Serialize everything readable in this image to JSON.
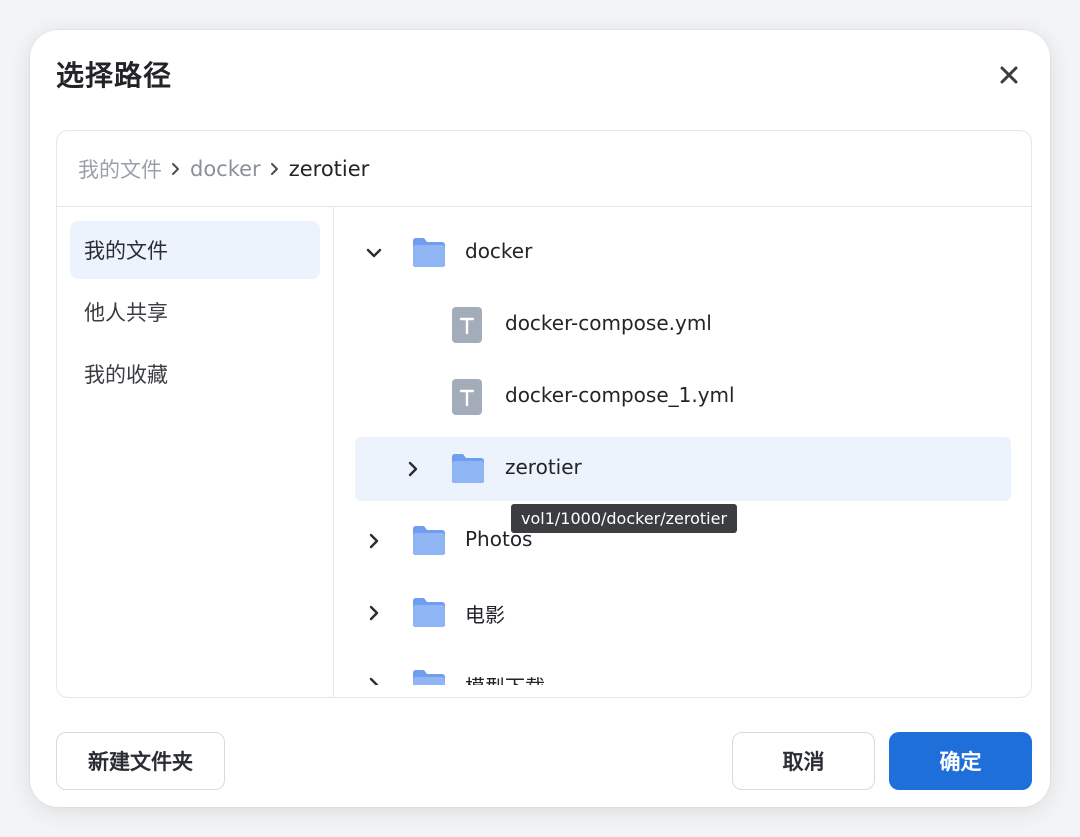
{
  "dialog": {
    "title": "选择路径",
    "close_icon": "close-icon"
  },
  "breadcrumb": {
    "items": [
      "我的文件",
      "docker",
      "zerotier"
    ]
  },
  "sidebar": {
    "items": [
      {
        "label": "我的文件",
        "active": true
      },
      {
        "label": "他人共享",
        "active": false
      },
      {
        "label": "我的收藏",
        "active": false
      }
    ]
  },
  "tree": {
    "rows": [
      {
        "label": "docker",
        "type": "folder",
        "expanded": true,
        "level": 0
      },
      {
        "label": "docker-compose.yml",
        "type": "file",
        "level": 1
      },
      {
        "label": "docker-compose_1.yml",
        "type": "file",
        "level": 1
      },
      {
        "label": "zerotier",
        "type": "folder",
        "expanded": false,
        "level": 1,
        "selected": true
      },
      {
        "label": "Photos",
        "type": "folder",
        "expanded": false,
        "level": 0
      },
      {
        "label": "电影",
        "type": "folder",
        "expanded": false,
        "level": 0
      },
      {
        "label": "模型下载",
        "type": "folder",
        "expanded": false,
        "level": 0
      }
    ]
  },
  "tooltip": {
    "text": "vol1/1000/docker/zerotier"
  },
  "footer": {
    "new_folder_label": "新建文件夹",
    "cancel_label": "取消",
    "confirm_label": "确定"
  },
  "colors": {
    "primary": "#1f6fdb",
    "selected_bg": "#edf3fc",
    "folder": "#8fb5f5"
  }
}
